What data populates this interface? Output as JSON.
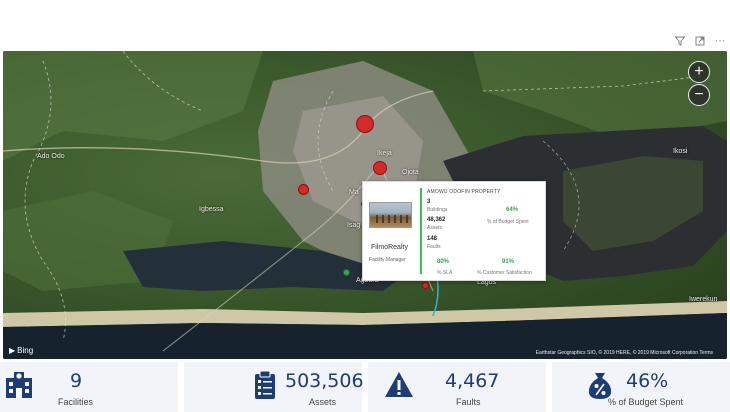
{
  "visual_header": {
    "icons": [
      "filter-icon",
      "focus-mode-icon",
      "more-options-icon"
    ],
    "more": "···"
  },
  "map": {
    "zoom_in": "+",
    "zoom_out": "−",
    "places": {
      "ado_odo": "Ado Odo",
      "igbessa": "Igbessa",
      "ikeja": "Ikeja",
      "ojota": "Ojota",
      "ikosi": "Ikosi",
      "agbara": "Agbara",
      "lagos": "Lagos",
      "mushin": "Ma",
      "isolo": "Isag",
      "iwerekun": "Iwerekun"
    },
    "attribution": "Bing",
    "copyright": "Earthstar Geographics SIO, © 2019 HERE, © 2019 Microsoft Corporation Terms"
  },
  "tooltip": {
    "property": "AMOWU ODOFIN PROPERTY",
    "company": "FilmoRealty",
    "role": "Facility Manager",
    "buildings": {
      "value": "3",
      "label": "Buildings"
    },
    "assets": {
      "value": "48,362",
      "label": "Assets"
    },
    "faults": {
      "value": "148",
      "label": "Faults"
    },
    "budget": {
      "value": "64%",
      "label": "% of Budget Spent"
    },
    "sla": {
      "value": "80%",
      "label": "% SLA"
    },
    "satisfaction": {
      "value": "91%",
      "label": "% Customer Satisfaction"
    }
  },
  "kpis": {
    "facilities": {
      "value": "9",
      "label": "Facilities",
      "icon": "hospital-building-icon"
    },
    "assets": {
      "value": "503,506",
      "label": "Assets",
      "icon": "clipboard-icon"
    },
    "faults": {
      "value": "4,467",
      "label": "Faults",
      "icon": "warning-icon"
    },
    "budget": {
      "value": "46%",
      "label": "% of Budget Spent",
      "icon": "money-bag-icon"
    }
  },
  "colors": {
    "kpi_value": "#1d3d74",
    "marker": "#d42a2a",
    "accent_green": "#3dba5a"
  }
}
